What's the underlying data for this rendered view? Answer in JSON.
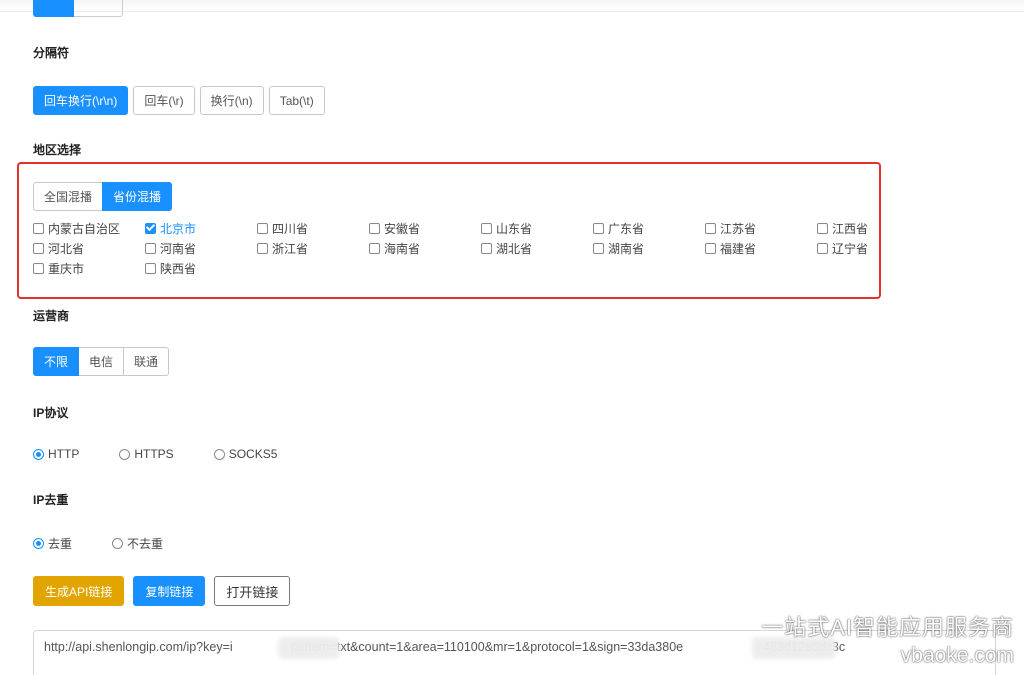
{
  "separator": {
    "label": "分隔符",
    "options": [
      "回车换行(\\r\\n)",
      "回车(\\r)",
      "换行(\\n)",
      "Tab(\\t)"
    ],
    "selected": "回车换行(\\r\\n)"
  },
  "region": {
    "label": "地区选择",
    "modes": [
      "全国混播",
      "省份混播"
    ],
    "selected_mode": "省份混播",
    "provinces": [
      {
        "name": "内蒙古自治区",
        "checked": false
      },
      {
        "name": "北京市",
        "checked": true
      },
      {
        "name": "四川省",
        "checked": false
      },
      {
        "name": "安徽省",
        "checked": false
      },
      {
        "name": "山东省",
        "checked": false
      },
      {
        "name": "广东省",
        "checked": false
      },
      {
        "name": "江苏省",
        "checked": false
      },
      {
        "name": "江西省",
        "checked": false
      },
      {
        "name": "河北省",
        "checked": false
      },
      {
        "name": "河南省",
        "checked": false
      },
      {
        "name": "浙江省",
        "checked": false
      },
      {
        "name": "海南省",
        "checked": false
      },
      {
        "name": "湖北省",
        "checked": false
      },
      {
        "name": "湖南省",
        "checked": false
      },
      {
        "name": "福建省",
        "checked": false
      },
      {
        "name": "辽宁省",
        "checked": false
      },
      {
        "name": "重庆市",
        "checked": false
      },
      {
        "name": "陕西省",
        "checked": false
      }
    ],
    "highlight_color": "#e53030"
  },
  "operator": {
    "label": "运营商",
    "options": [
      "不限",
      "电信",
      "联通"
    ],
    "selected": "不限"
  },
  "protocol": {
    "label": "IP协议",
    "options": [
      "HTTP",
      "HTTPS",
      "SOCKS5"
    ],
    "selected": "HTTP"
  },
  "dedupe": {
    "label": "IP去重",
    "options": [
      "去重",
      "不去重"
    ],
    "selected": "去重"
  },
  "actions": {
    "generate": "生成API链接",
    "copy": "复制链接",
    "open": "打开链接"
  },
  "url": {
    "part1": "http://api.shenlongip.com/ip?key=i",
    "part2": "pattern=txt&count=1&area=110100&mr=1&protocol=1&sign=33da380e",
    "part3": "463d12e6dc3c"
  },
  "watermark": {
    "line1": "一站式AI智能应用服务商",
    "line2": "vbaoke.com"
  },
  "colors": {
    "primary": "#1890ff",
    "generate": "#e2a500"
  }
}
